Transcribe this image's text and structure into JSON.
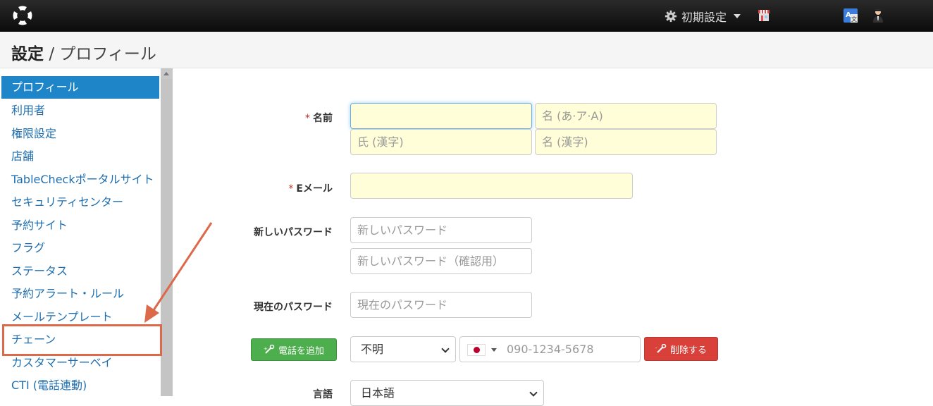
{
  "topbar": {
    "settings_label": "初期設定",
    "icons": [
      "logo-icon",
      "gear-icon",
      "store-icon",
      "translate-icon",
      "user-icon"
    ]
  },
  "header": {
    "title": "設定",
    "separator": "/",
    "subtitle": "プロフィール"
  },
  "sidebar": {
    "items": [
      {
        "label": "プロフィール",
        "active": true
      },
      {
        "label": "利用者"
      },
      {
        "label": "権限設定"
      },
      {
        "label": "店舗"
      },
      {
        "label": "TableCheckポータルサイト"
      },
      {
        "label": "セキュリティセンター"
      },
      {
        "label": "予約サイト"
      },
      {
        "label": "フラグ"
      },
      {
        "label": "ステータス"
      },
      {
        "label": "予約アラート・ルール"
      },
      {
        "label": "メールテンプレート"
      },
      {
        "label": "チェーン"
      },
      {
        "label": "カスタマーサーベイ"
      },
      {
        "label": "CTI (電話連動)"
      }
    ]
  },
  "form": {
    "name_label": "名前",
    "required_mark": "*",
    "name_fields": {
      "last_kana": {
        "value": "",
        "placeholder": ""
      },
      "first_kana": {
        "value": "",
        "placeholder": "名 (あ·ア·A)"
      },
      "last_kanji": {
        "value": "",
        "placeholder": "氏 (漢字)"
      },
      "first_kanji": {
        "value": "",
        "placeholder": "名 (漢字)"
      }
    },
    "email_label": "Eメール",
    "email_value": "",
    "new_password_label": "新しいパスワード",
    "new_password_placeholder": "新しいパスワード",
    "new_password_confirm_placeholder": "新しいパスワード（確認用）",
    "current_password_label": "現在のパスワード",
    "current_password_placeholder": "現在のパスワード",
    "add_phone_button": "電話を追加",
    "phone_type": "不明",
    "phone_placeholder": "090-1234-5678",
    "delete_button": "削除する",
    "language_label": "言語",
    "language_value": "日本語"
  },
  "colors": {
    "accent": "#1e85c8",
    "annotation": "#dc6a4a",
    "add_button": "#4cae4c",
    "delete_button": "#d9403a",
    "input_highlight": "#fffed8"
  }
}
